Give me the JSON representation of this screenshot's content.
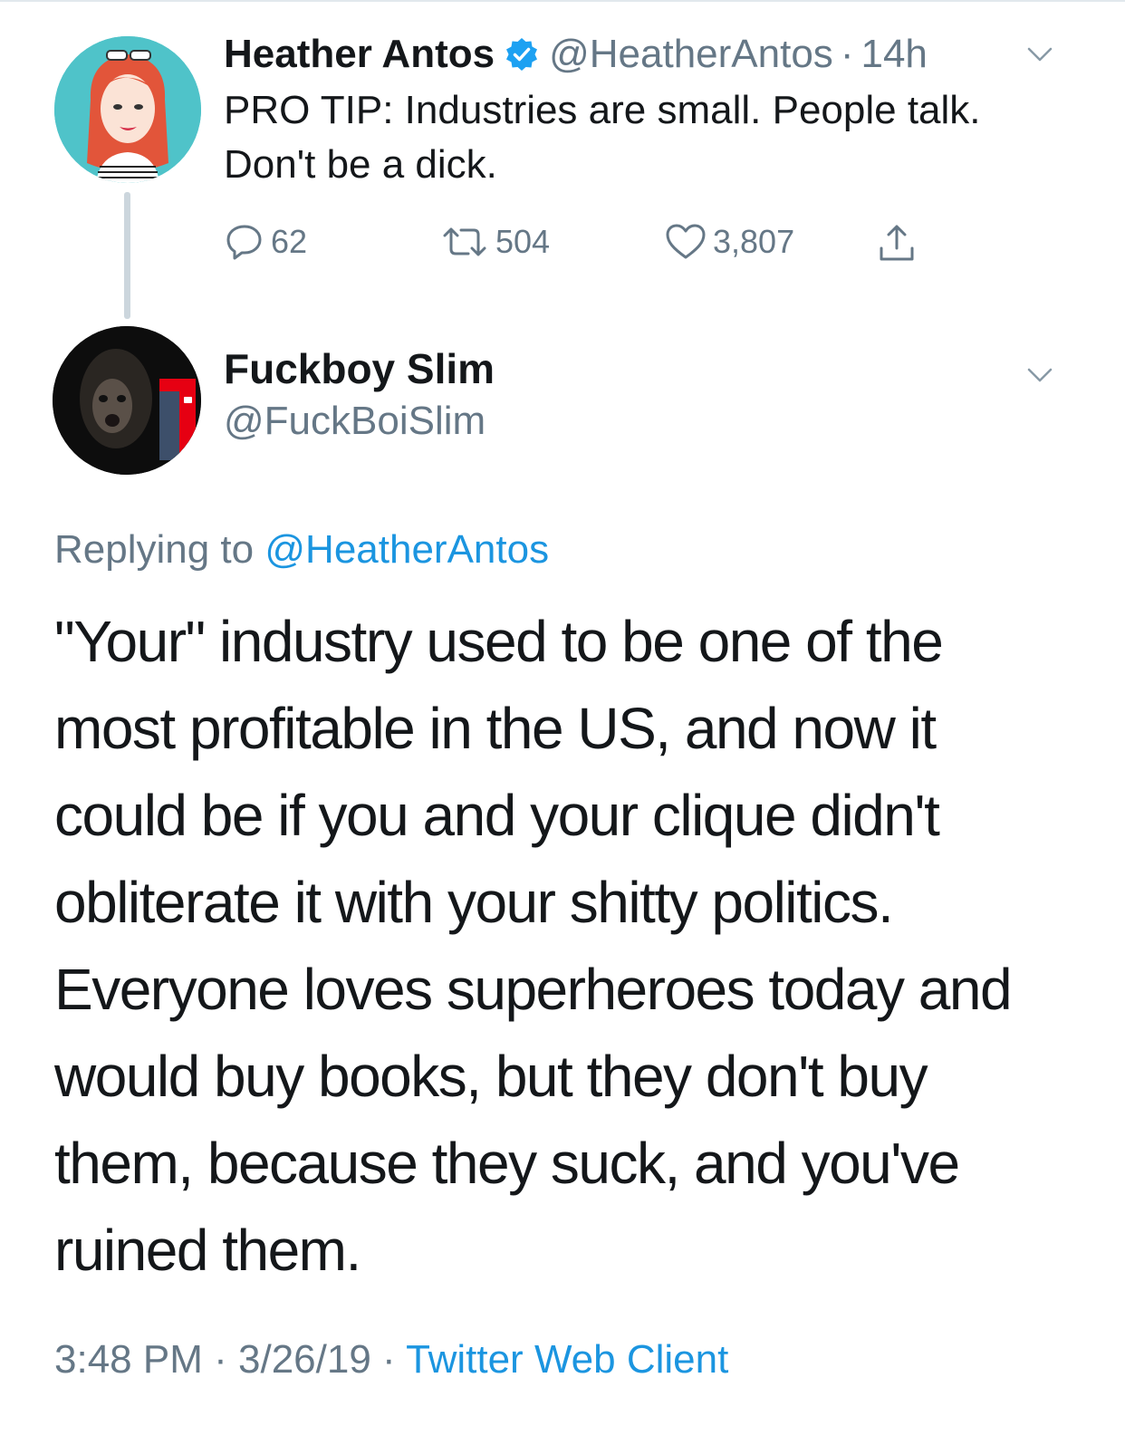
{
  "parent_tweet": {
    "display_name": "Heather Antos",
    "verified": true,
    "handle": "@HeatherAntos",
    "separator": "·",
    "age": "14h",
    "text_line1": "PRO TIP: Industries are small. People talk.",
    "text_line2": "Don't be a dick.",
    "replies": "62",
    "retweets": "504",
    "likes": "3,807",
    "menu_icon": "chevron-down-icon"
  },
  "reply_tweet": {
    "display_name": "Fuckboy Slim",
    "handle": "@FuckBoiSlim",
    "replying_to_label": "Replying to",
    "replying_to_handle": "@HeatherAntos",
    "text_lines": [
      "\"Your\" industry used to be one of the",
      "most profitable in the US, and now it",
      "could be if you and your clique didn't",
      "obliterate it with your shitty politics.",
      "Everyone loves superheroes today and",
      "would buy books, but they don't buy",
      "them, because they suck, and you've",
      "ruined them."
    ],
    "time": "3:48 PM",
    "separator": "·",
    "date": "3/26/19",
    "source": "Twitter Web Client",
    "menu_icon": "chevron-down-icon"
  },
  "colors": {
    "text": "#14171a",
    "secondary": "#657786",
    "link": "#1b95e0",
    "verified": "#1da1f2",
    "thread_line": "#ccd6dd"
  }
}
